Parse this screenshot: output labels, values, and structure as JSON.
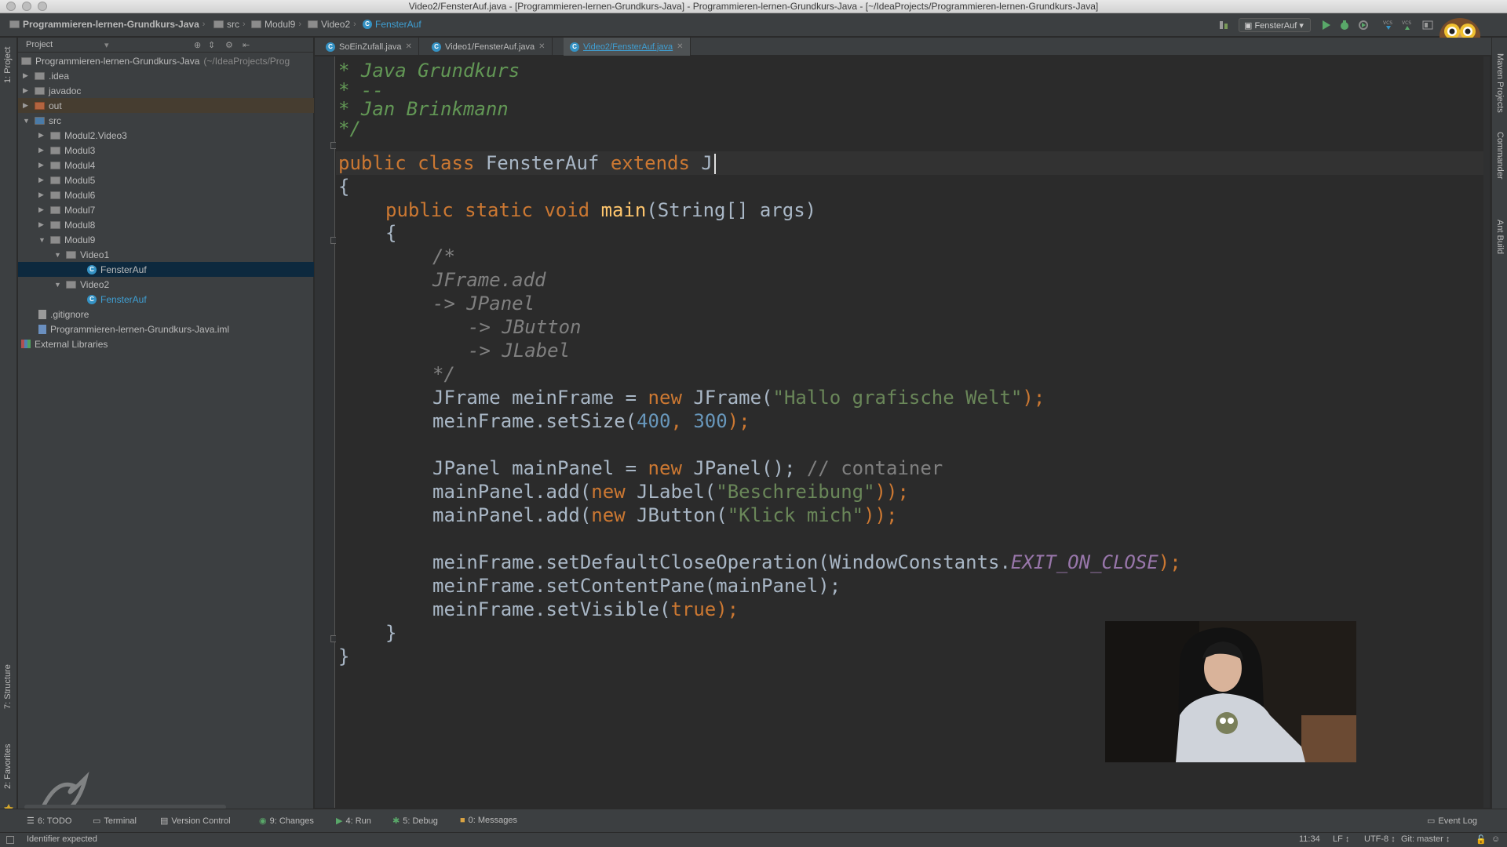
{
  "window": {
    "title": "Video2/FensterAuf.java - [Programmieren-lernen-Grundkurs-Java] - Programmieren-lernen-Grundkurs-Java - [~/IdeaProjects/Programmieren-lernen-Grundkurs-Java]"
  },
  "breadcrumbs": [
    "Programmieren-lernen-Grundkurs-Java",
    "src",
    "Modul9",
    "Video2",
    "FensterAuf"
  ],
  "toolbar": {
    "run_config": "FensterAuf"
  },
  "project_panel": {
    "header": "Project",
    "tree": [
      {
        "label": "Programmieren-lernen-Grundkurs-Java",
        "suffix": "(~/IdeaProjects/Prog",
        "type": "module",
        "depth": 0
      },
      {
        "label": ".idea",
        "type": "folder",
        "depth": 1
      },
      {
        "label": "javadoc",
        "type": "folder",
        "depth": 1
      },
      {
        "label": "out",
        "type": "folder-red",
        "depth": 1
      },
      {
        "label": "src",
        "type": "folder",
        "depth": 1
      },
      {
        "label": "Modul2.Video3",
        "type": "folder",
        "depth": 2
      },
      {
        "label": "Modul3",
        "type": "folder",
        "depth": 2
      },
      {
        "label": "Modul4",
        "type": "folder",
        "depth": 2
      },
      {
        "label": "Modul5",
        "type": "folder",
        "depth": 2
      },
      {
        "label": "Modul6",
        "type": "folder",
        "depth": 2
      },
      {
        "label": "Modul7",
        "type": "folder",
        "depth": 2
      },
      {
        "label": "Modul8",
        "type": "folder",
        "depth": 2
      },
      {
        "label": "Modul9",
        "type": "folder",
        "depth": 2
      },
      {
        "label": "Video1",
        "type": "folder",
        "depth": 3
      },
      {
        "label": "FensterAuf",
        "type": "class",
        "depth": 4
      },
      {
        "label": "Video2",
        "type": "folder",
        "depth": 3
      },
      {
        "label": "FensterAuf",
        "type": "class",
        "depth": 4
      },
      {
        "label": ".gitignore",
        "type": "file",
        "depth": 1
      },
      {
        "label": "Programmieren-lernen-Grundkurs-Java.iml",
        "type": "file",
        "depth": 1
      },
      {
        "label": "External Libraries",
        "type": "libs",
        "depth": 0
      }
    ]
  },
  "tabs": [
    {
      "label": "SoEinZufall.java"
    },
    {
      "label": "Video1/FensterAuf.java"
    },
    {
      "label": "Video2/FensterAuf.java"
    }
  ],
  "code": {
    "l1": "* Java Grundkurs",
    "l2": "* --",
    "l3": "* Jan Brinkmann",
    "l4": "*/",
    "kw_public": "public",
    "kw_class": "class",
    "classname": "FensterAuf",
    "kw_extends": "extends",
    "typed": "J",
    "brace_open": "{",
    "kw_static": "static",
    "kw_void": "void",
    "main": "main",
    "main_args": "(String[] args)",
    "c1": "/*",
    "c2": "JFrame.add",
    "c3": "-> JPanel",
    "c4": "-> JButton",
    "c5": "-> JLabel",
    "c6": "*/",
    "frame_decl": "JFrame meinFrame = ",
    "kw_new": "new",
    "frame_ctor": " JFrame(",
    "frame_str": "\"Hallo grafische Welt\"",
    "close_semi": ");",
    "setsize": "meinFrame.setSize(",
    "n400": "400",
    "comma": ", ",
    "n300": "300",
    "panel_decl": "JPanel mainPanel = ",
    "panel_ctor": " JPanel();",
    "panel_comment": " // container",
    "add_open": "mainPanel.add(",
    "label_ctor": " JLabel(",
    "label_str": "\"Beschreibung\"",
    "button_ctor": " JButton(",
    "button_str": "\"Klick mich\"",
    "close2": "));",
    "setclose": "meinFrame.setDefaultCloseOperation(WindowConstants.",
    "exit_const": "EXIT_ON_CLOSE",
    "setcontent": "meinFrame.setContentPane(mainPanel);",
    "setvisible": "meinFrame.setVisible(",
    "kw_true": "true",
    "brace_close": "}"
  },
  "tool_windows": {
    "todo": "6: TODO",
    "terminal": "Terminal",
    "vcs": "Version Control",
    "changes": "9: Changes",
    "run": "4: Run",
    "debug": "5: Debug",
    "messages": "0: Messages",
    "event_log": "Event Log",
    "left_project": "1: Project",
    "left_structure": "7: Structure",
    "left_favorites": "2: Favorites",
    "right_maven": "Maven Projects",
    "right_commander": "Commander",
    "right_ant": "Ant Build"
  },
  "status": {
    "message": "Identifier expected",
    "position": "11:34",
    "line_sep": "LF ↕",
    "encoding": "UTF-8 ↕",
    "git": "Git: master ↕"
  },
  "colors": {
    "editor_bg": "#2b2b2b",
    "keyword": "#cc7832",
    "string": "#6a8759",
    "number": "#6897bb",
    "comment": "#808080",
    "function": "#ffc66d",
    "active_tab": "#3f9fd3"
  }
}
